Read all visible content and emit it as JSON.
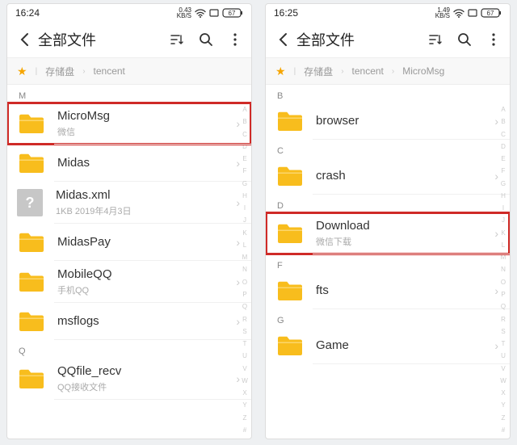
{
  "alpha_index": [
    "A",
    "B",
    "C",
    "D",
    "E",
    "F",
    "G",
    "H",
    "I",
    "J",
    "K",
    "L",
    "M",
    "N",
    "O",
    "P",
    "Q",
    "R",
    "S",
    "T",
    "U",
    "V",
    "W",
    "X",
    "Y",
    "Z",
    "#"
  ],
  "screens": [
    {
      "status": {
        "time": "16:24",
        "net": "0.43\nKB/S",
        "battery": "67"
      },
      "title": "全部文件",
      "breadcrumb": [
        "存储盘",
        "tencent"
      ],
      "groups": [
        {
          "label": "M",
          "items": [
            {
              "kind": "folder",
              "title": "MicroMsg",
              "sub": "微信",
              "highlight": true
            },
            {
              "kind": "folder",
              "title": "Midas",
              "sub": ""
            },
            {
              "kind": "file",
              "title": "Midas.xml",
              "sub": "1KB  2019年4月3日"
            },
            {
              "kind": "folder",
              "title": "MidasPay",
              "sub": ""
            },
            {
              "kind": "folder",
              "title": "MobileQQ",
              "sub": "手机QQ"
            },
            {
              "kind": "folder",
              "title": "msflogs",
              "sub": ""
            }
          ]
        },
        {
          "label": "Q",
          "items": [
            {
              "kind": "folder",
              "title": "QQfile_recv",
              "sub": "QQ接收文件"
            }
          ]
        }
      ]
    },
    {
      "status": {
        "time": "16:25",
        "net": "1.49\nKB/S",
        "battery": "67"
      },
      "title": "全部文件",
      "breadcrumb": [
        "存储盘",
        "tencent",
        "MicroMsg"
      ],
      "groups": [
        {
          "label": "B",
          "items": [
            {
              "kind": "folder",
              "title": "browser",
              "sub": ""
            }
          ]
        },
        {
          "label": "C",
          "items": [
            {
              "kind": "folder",
              "title": "crash",
              "sub": ""
            }
          ]
        },
        {
          "label": "D",
          "items": [
            {
              "kind": "folder",
              "title": "Download",
              "sub": "微信下载",
              "highlight": true
            }
          ]
        },
        {
          "label": "F",
          "items": [
            {
              "kind": "folder",
              "title": "fts",
              "sub": ""
            }
          ]
        },
        {
          "label": "G",
          "items": [
            {
              "kind": "folder",
              "title": "Game",
              "sub": ""
            }
          ]
        }
      ]
    }
  ]
}
